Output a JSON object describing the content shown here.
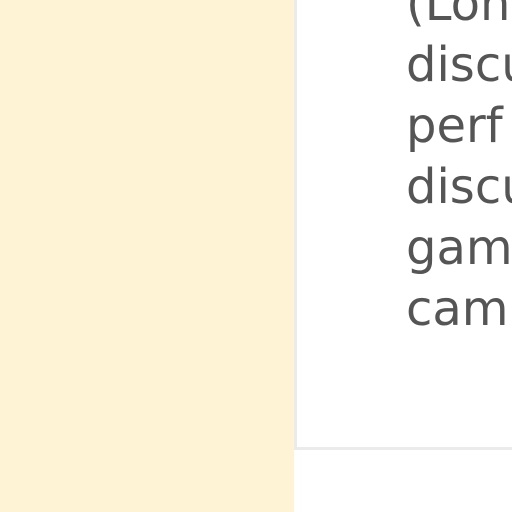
{
  "card": {
    "lines": [
      "(Lon",
      "discu",
      "perf",
      "discu",
      "gam",
      "cam"
    ]
  }
}
